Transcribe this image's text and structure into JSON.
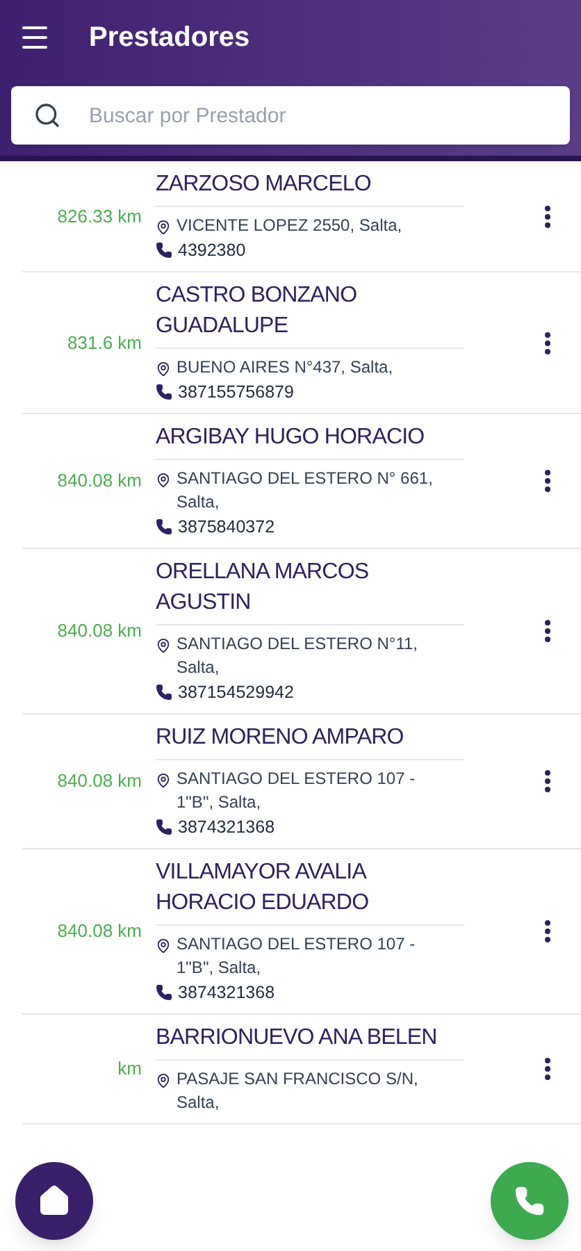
{
  "header": {
    "title": "Prestadores"
  },
  "search": {
    "placeholder": "Buscar por Prestador"
  },
  "providers": [
    {
      "distance": "826.33 km",
      "name": "ZARZOSO MARCELO",
      "address": "VICENTE LOPEZ 2550, Salta,",
      "phone": "4392380"
    },
    {
      "distance": "831.6 km",
      "name": "CASTRO BONZANO GUADALUPE",
      "address": "BUENO AIRES N°437, Salta,",
      "phone": "387155756879"
    },
    {
      "distance": "840.08 km",
      "name": "ARGIBAY HUGO HORACIO",
      "address": "SANTIAGO DEL ESTERO N° 661, Salta,",
      "phone": "3875840372"
    },
    {
      "distance": "840.08 km",
      "name": "ORELLANA MARCOS AGUSTIN",
      "address": "SANTIAGO DEL ESTERO N°11, Salta,",
      "phone": "387154529942"
    },
    {
      "distance": "840.08 km",
      "name": "RUIZ MORENO AMPARO",
      "address": "SANTIAGO DEL ESTERO 107 - 1\"B\", Salta,",
      "phone": "3874321368"
    },
    {
      "distance": "840.08 km",
      "name": "VILLAMAYOR AVALIA HORACIO EDUARDO",
      "address": "SANTIAGO DEL ESTERO 107 - 1\"B\", Salta,",
      "phone": "3874321368"
    },
    {
      "distance": "km",
      "name": "BARRIONUEVO ANA BELEN",
      "address": "PASAJE SAN FRANCISCO S/N, Salta,"
    }
  ]
}
